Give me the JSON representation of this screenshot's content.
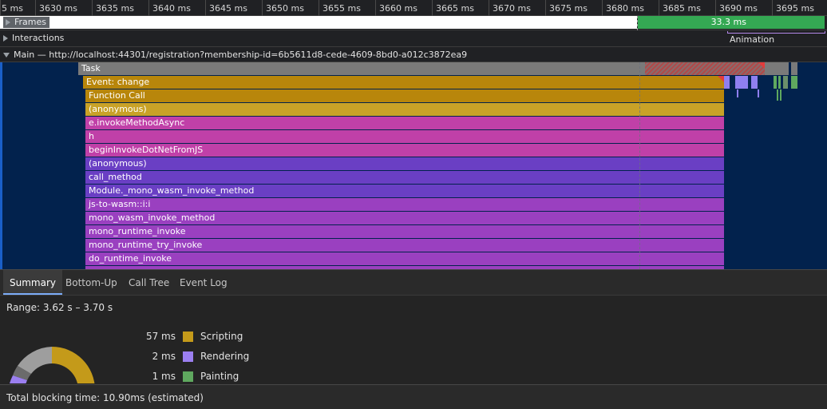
{
  "ruler": {
    "ticks": [
      "5 ms",
      "3630 ms",
      "3635 ms",
      "3640 ms",
      "3645 ms",
      "3650 ms",
      "3655 ms",
      "3660 ms",
      "3665 ms",
      "3670 ms",
      "3675 ms",
      "3680 ms",
      "3685 ms",
      "3690 ms",
      "3695 ms"
    ]
  },
  "tracks": {
    "frames": {
      "label": "Frames",
      "frame_duration": "33.3 ms"
    },
    "interactions": {
      "label": "Interactions",
      "interaction_type": "Animation"
    },
    "main": {
      "label": "Main — http://localhost:44301/registration?membership-id=6b5611d8-cede-4609-8bd0-a012c3872ea9"
    }
  },
  "flame": {
    "entries": [
      {
        "label": "Task",
        "color": "#7a7a7a"
      },
      {
        "label": "Event: change",
        "color": "#b8860b"
      },
      {
        "label": "Function Call",
        "color": "#b8860b"
      },
      {
        "label": "(anonymous)",
        "color": "#c9a227"
      },
      {
        "label": "e.invokeMethodAsync",
        "color": "#c040a8"
      },
      {
        "label": "h",
        "color": "#c040a8"
      },
      {
        "label": "beginInvokeDotNetFromJS",
        "color": "#c040a8"
      },
      {
        "label": "(anonymous)",
        "color": "#6a3fc4"
      },
      {
        "label": "call_method",
        "color": "#6a3fc4"
      },
      {
        "label": "Module._mono_wasm_invoke_method",
        "color": "#6a3fc4"
      },
      {
        "label": "js-to-wasm::i:i",
        "color": "#9a40c0"
      },
      {
        "label": "mono_wasm_invoke_method",
        "color": "#9a40c0"
      },
      {
        "label": "mono_runtime_invoke",
        "color": "#9a40c0"
      },
      {
        "label": "mono_runtime_try_invoke",
        "color": "#9a40c0"
      },
      {
        "label": "do_runtime_invoke",
        "color": "#9a40c0"
      }
    ]
  },
  "tabs": {
    "summary": "Summary",
    "bottom_up": "Bottom-Up",
    "call_tree": "Call Tree",
    "event_log": "Event Log"
  },
  "summary": {
    "range": "Range: 3.62 s – 3.70 s",
    "categories": [
      {
        "value": "57 ms",
        "name": "Scripting",
        "color": "#c49a1a"
      },
      {
        "value": "2 ms",
        "name": "Rendering",
        "color": "#9b7ff0"
      },
      {
        "value": "1 ms",
        "name": "Painting",
        "color": "#5fa85f"
      }
    ]
  },
  "footer": {
    "text": "Total blocking time: 10.90ms (estimated)"
  }
}
